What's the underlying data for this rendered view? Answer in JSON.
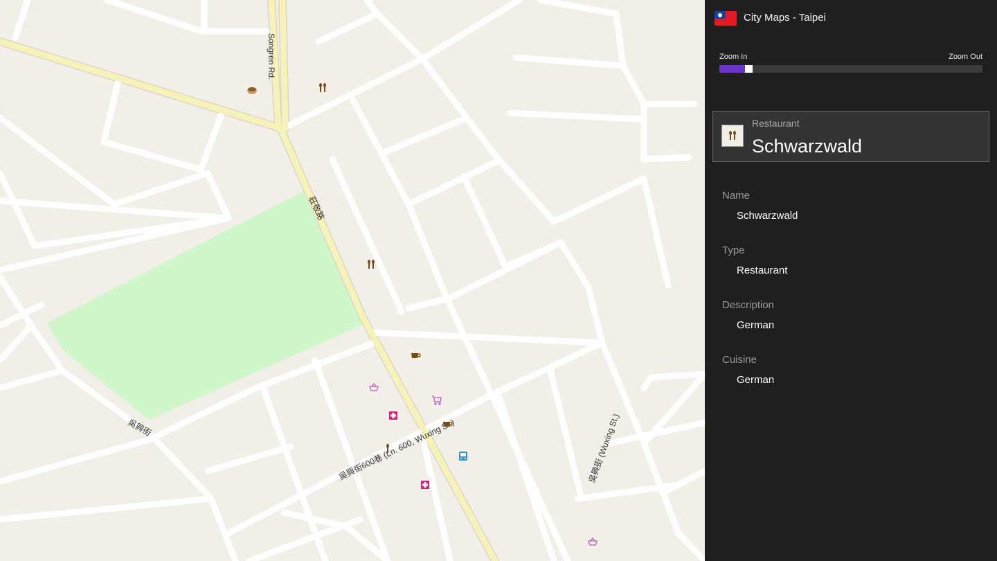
{
  "app": {
    "title": "City Maps - Taipei",
    "flag_icon": "taiwan-flag-icon"
  },
  "zoom": {
    "in_label": "Zoom In",
    "out_label": "Zoom Out",
    "level_fraction": 0.1
  },
  "selected_poi": {
    "type": "Restaurant",
    "name": "Schwarzwald",
    "icon": "restaurant-icon"
  },
  "details": [
    {
      "label": "Name",
      "value": "Schwarzwald"
    },
    {
      "label": "Type",
      "value": "Restaurant"
    },
    {
      "label": "Description",
      "value": "German"
    },
    {
      "label": "Cuisine",
      "value": "German"
    }
  ],
  "map": {
    "road_labels": {
      "songren": "Songren Rd.",
      "zhuangjing": "莊敬路",
      "wuxing": "吳興街",
      "wuxing_lane": "吳興街600巷 (Ln. 600, Wuxing St.)",
      "wuxing_st": "吳興街 (Wuxing St.)"
    },
    "colors": {
      "land": "#f2efe9",
      "road": "#ffffff",
      "major_road": "#f7f3b8",
      "park": "#cff7c9",
      "restaurant": "#7a4a14",
      "medical": "#d7257d",
      "shop": "#c070c0",
      "bus": "#2d8fd6"
    }
  }
}
